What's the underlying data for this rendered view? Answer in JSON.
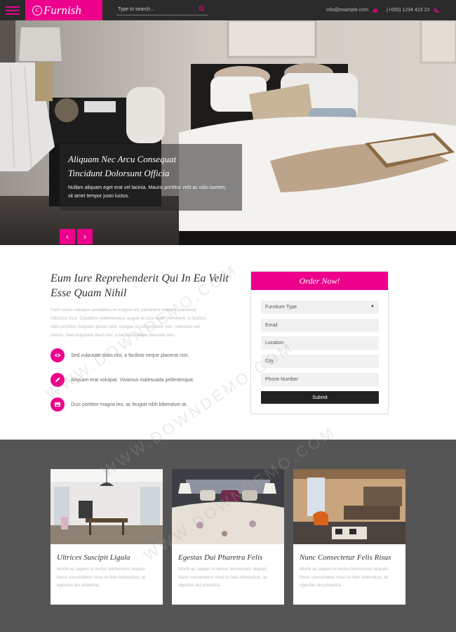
{
  "brand": {
    "logo_text": "Furnish",
    "logo_mark": "C"
  },
  "search": {
    "placeholder": "Type to search..."
  },
  "contact": {
    "email": "info@example.com",
    "phone": "(+000) 1234 423 23"
  },
  "hero": {
    "title_line1": "Aliquam Nec Arcu Consequat",
    "title_line2": "Tincidunt Dolorsunt Officia",
    "text_line1": "Nullam aliquam eget erat vel lacinia. Mauris porttitor velit ac odio laoreet,",
    "text_line2": "sit amet tempor justo luctus.",
    "prev_label": "‹",
    "next_label": "›"
  },
  "intro": {
    "title_line1": "Eum Iure Reprehenderit Qui In Ea Velit",
    "title_line2": "Esse Quam Nihil",
    "desc_lines": [
      "Cum sociis natoque penatibus et magnis dis parturient montes, nascetur",
      "ridiculus mus. Curabitur pellentesque augue ut arcu enim hendrerit, a facilisis",
      "nibh porttitor. Aliquam purus velit, congue id consectetur non, interdum vel",
      "metus. Sed vulputate diam nisi, a facilisis neque placerat non."
    ],
    "features": [
      {
        "icon": "eye-icon",
        "text": "Sed vulputate diam nisi, a facilisis neque placerat non."
      },
      {
        "icon": "pencil-icon",
        "text": "Aliquam erat volutpat. Vivamus malesuada pellentesque."
      },
      {
        "icon": "photo-icon",
        "text": "Duis porttitor magna leo, ac feugiat nibh bibendum at."
      }
    ]
  },
  "order": {
    "title": "Order Now!",
    "type_select": "Furniture Type",
    "email": "Email",
    "location": "Location",
    "city": "City",
    "phone": "Phone Number",
    "submit": "Submit"
  },
  "cards": [
    {
      "title": "Ultrices Suscipit Ligula",
      "lines": [
        "Morbi ac sapien id lectus fermentum aliquet.",
        "Nunc consectetur risus et felis bibendum, at",
        "egestas dui pharetra."
      ]
    },
    {
      "title": "Egestas Dui Pharetra Felis",
      "lines": [
        "Morbi ac sapien id lectus fermentum aliquet.",
        "Nunc consectetur risus et felis bibendum, at",
        "egestas dui pharetra."
      ]
    },
    {
      "title": "Nunc Consectetur Felis Risus",
      "lines": [
        "Morbi ac sapien id lectus fermentum aliquet.",
        "Nunc consectetur risus et felis bibendum, at",
        "egestas dui pharetra."
      ]
    }
  ],
  "watermark": "WWW.DOWNDEMO.COM",
  "colors": {
    "accent": "#ec008c",
    "topbar": "#2b2b2b",
    "bottom_bg": "#555555"
  }
}
